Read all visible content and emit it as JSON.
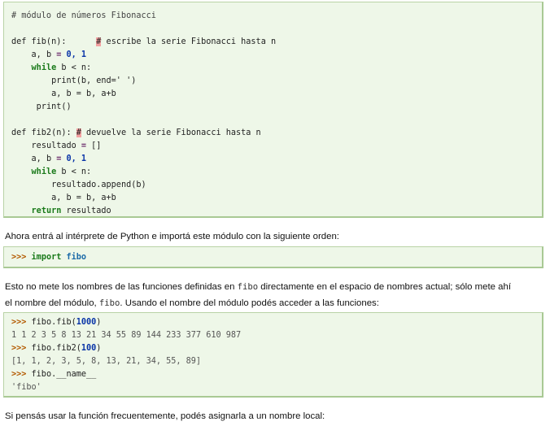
{
  "block1": {
    "comment": "# módulo de números Fibonacci",
    "fib_def": "def fib(n):",
    "fib_hash": "#",
    "fib_comment": " escribe la serie Fibonacci hasta n",
    "l_ab_pre": "a, b ",
    "eq": "=",
    "zero": "0",
    "comma": ", ",
    "one": "1",
    "while_kw": "while",
    "while_rest": " b < n:",
    "print_b": "print(b, end=' ')",
    "ab_update": "a, b = b, a+b",
    "print_empty": "print()",
    "fib2_def": "def fib2(n):",
    "fib2_hash": "#",
    "fib2_comment": " devuelve la serie Fibonacci hasta n",
    "resultado_pre": "resultado ",
    "empty_list": " []",
    "append": "resultado.append(b)",
    "return_kw": "return",
    "return_rest": " resultado"
  },
  "para1": "Ahora entrá al intérprete de Python e importá este módulo con la siguiente orden:",
  "block2": {
    "prompt": ">>>",
    "import_kw": "import",
    "module": "fibo"
  },
  "para2": {
    "a": "Esto no mete los nombres de las funciones definidas en ",
    "code1": "fibo",
    "b": " directamente en el espacio de nombres actual; sólo mete ahí",
    "c": "el nombre del módulo, ",
    "code2": "fibo",
    "d": ". Usando el nombre del módulo podés acceder a las funciones:"
  },
  "block3": {
    "prompt": ">>>",
    "call1_pre": " fibo.fib(",
    "call1_num": "1000",
    "call1_post": ")",
    "out1": "1 1 2 3 5 8 13 21 34 55 89 144 233 377 610 987",
    "call2_pre": " fibo.fib2(",
    "call2_num": "100",
    "call2_post": ")",
    "out2": "[1, 1, 2, 3, 5, 8, 13, 21, 34, 55, 89]",
    "call3_pre": " fibo.",
    "call3_name": "__name__",
    "out3": "'fibo'"
  },
  "para3": "Si pensás usar la función frecuentemente, podés asignarla a un nombre local:"
}
